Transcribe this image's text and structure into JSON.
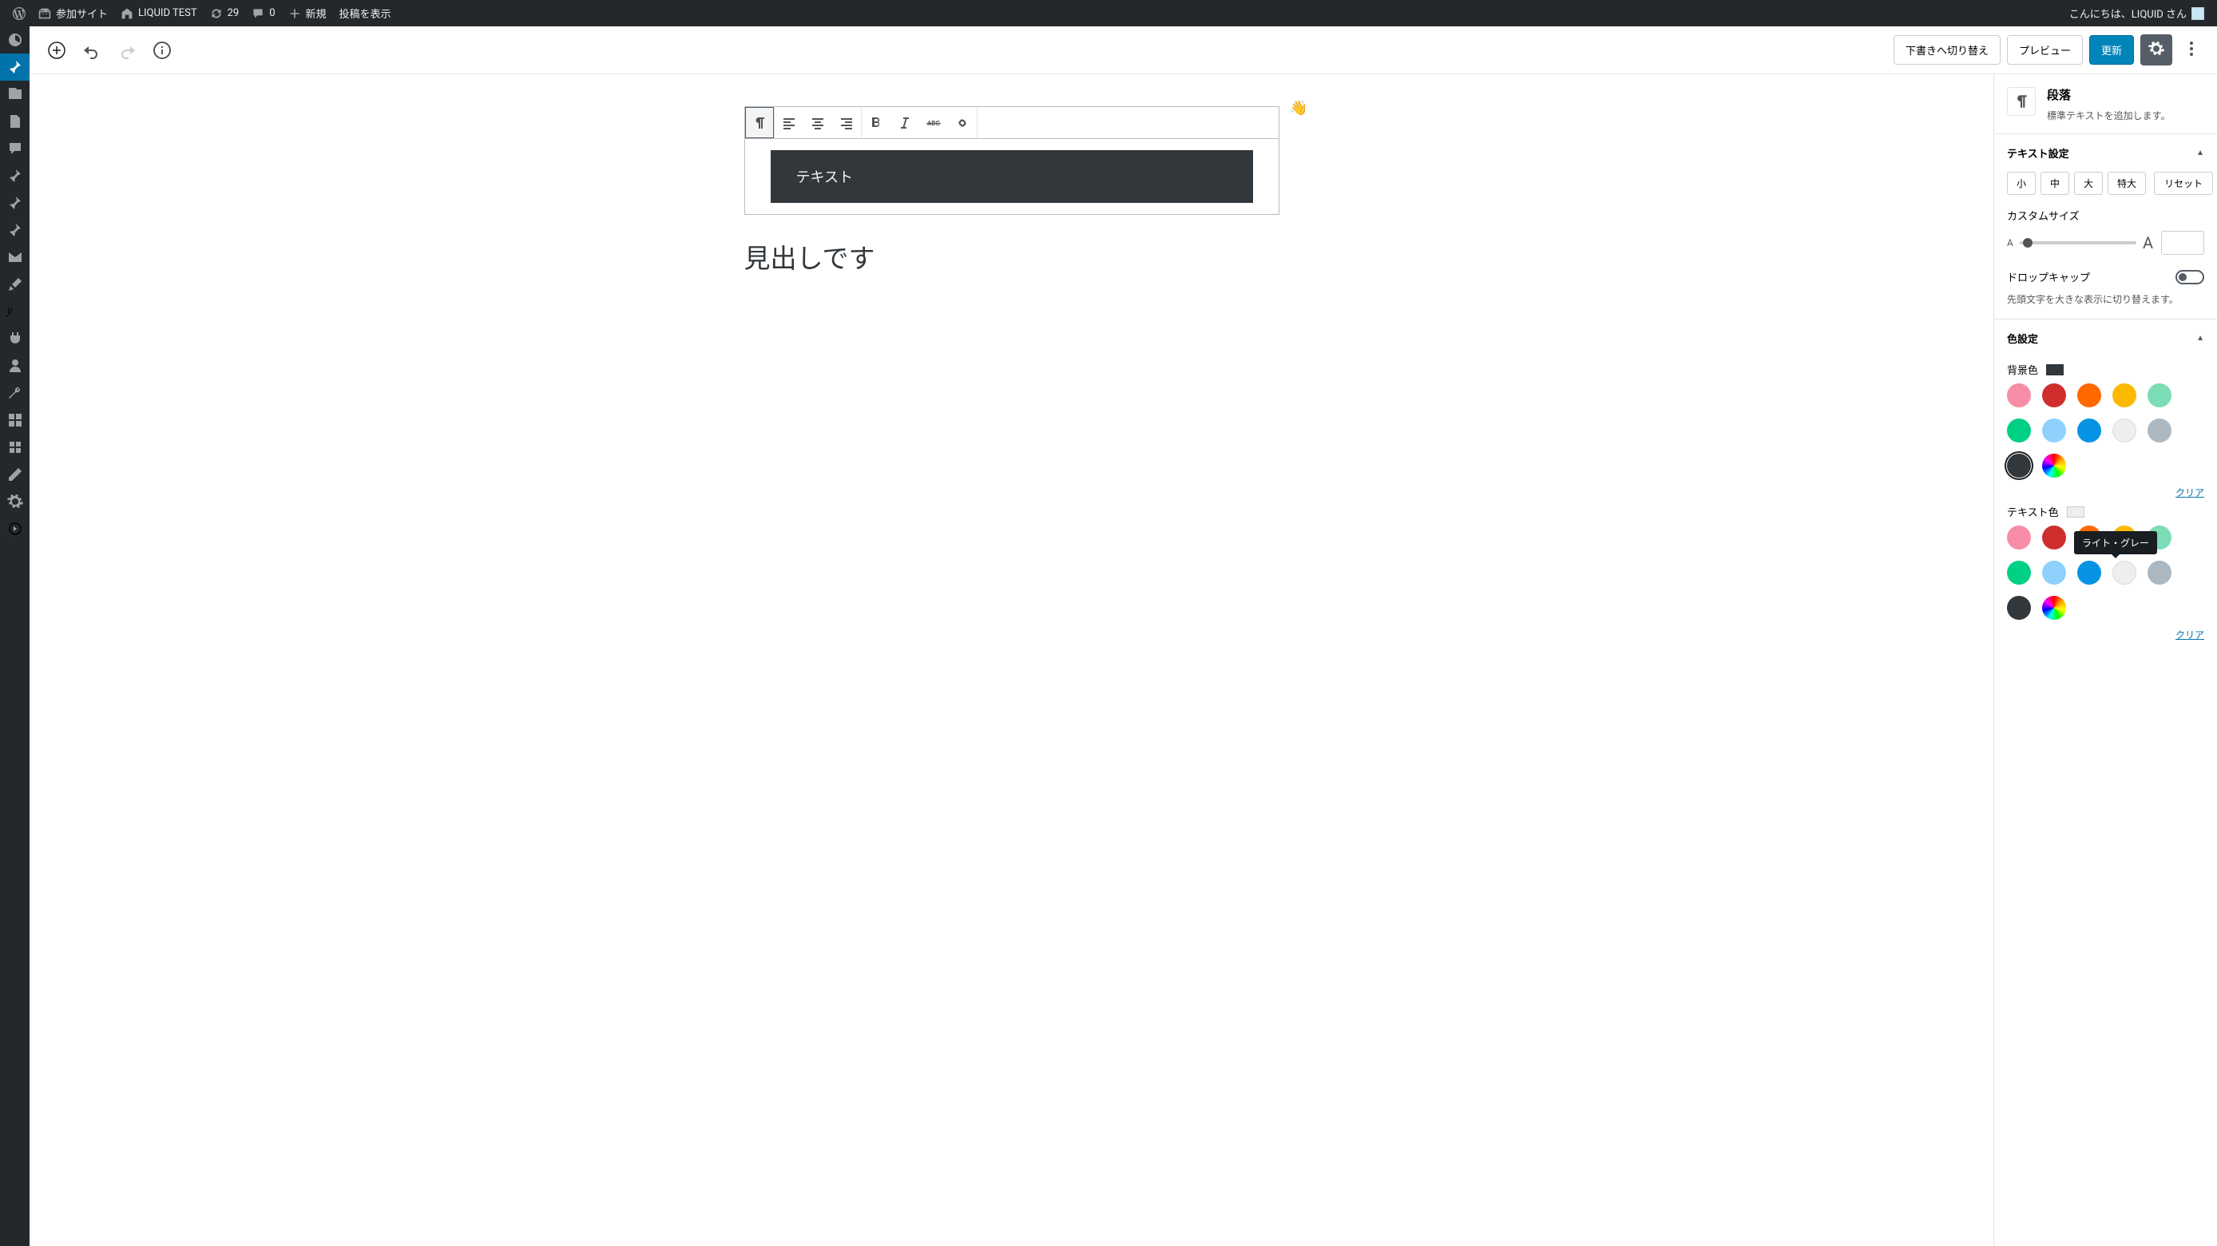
{
  "admin_bar": {
    "my_sites": "参加サイト",
    "site_name": "LIQUID TEST",
    "updates": "29",
    "comments": "0",
    "new": "新規",
    "view_post": "投稿を表示",
    "greeting": "こんにちは、LIQUID さん"
  },
  "editor_header": {
    "switch_draft": "下書きへ切り替え",
    "preview": "プレビュー",
    "update": "更新"
  },
  "canvas": {
    "wave_emoji": "👋",
    "text_block": "テキスト",
    "heading": "見出しです"
  },
  "panel": {
    "block_name": "段落",
    "block_desc": "標準テキストを追加します。",
    "text_settings": {
      "title": "テキスト設定",
      "sizes": [
        "小",
        "中",
        "大",
        "特大"
      ],
      "reset": "リセット",
      "custom_size": "カスタムサイズ",
      "a_small": "A",
      "a_large": "A",
      "dropcap": "ドロップキャップ",
      "dropcap_desc": "先頭文字を大きな表示に切り替えます。"
    },
    "color_settings": {
      "title": "色設定",
      "bg_label": "背景色",
      "bg_value": "#32373c",
      "text_label": "テキスト色",
      "text_value": "#eeeeee",
      "clear": "クリア",
      "palette_bg": [
        {
          "c": "#f78da7"
        },
        {
          "c": "#cf2e2e"
        },
        {
          "c": "#ff6900"
        },
        {
          "c": "#fcb900"
        },
        {
          "c": "#7bdcb5"
        },
        {
          "c": "#00d084"
        },
        {
          "c": "#8ed1fc"
        },
        {
          "c": "#0693e3"
        },
        {
          "c": "#eeeeee",
          "lightborder": true
        },
        {
          "c": "#abb8c2"
        },
        {
          "c": "#32373c",
          "selected_ring": true
        },
        {
          "c": "gradient"
        }
      ],
      "palette_text": [
        {
          "c": "#f78da7"
        },
        {
          "c": "#cf2e2e"
        },
        {
          "c": "#ff6900"
        },
        {
          "c": "#fcb900"
        },
        {
          "c": "#7bdcb5"
        },
        {
          "c": "#00d084"
        },
        {
          "c": "#8ed1fc"
        },
        {
          "c": "#0693e3"
        },
        {
          "c": "#eeeeee",
          "selected": true,
          "lightborder": true
        },
        {
          "c": "#abb8c2"
        },
        {
          "c": "#32373c"
        },
        {
          "c": "gradient"
        }
      ],
      "tooltip": "ライト・グレー"
    }
  }
}
